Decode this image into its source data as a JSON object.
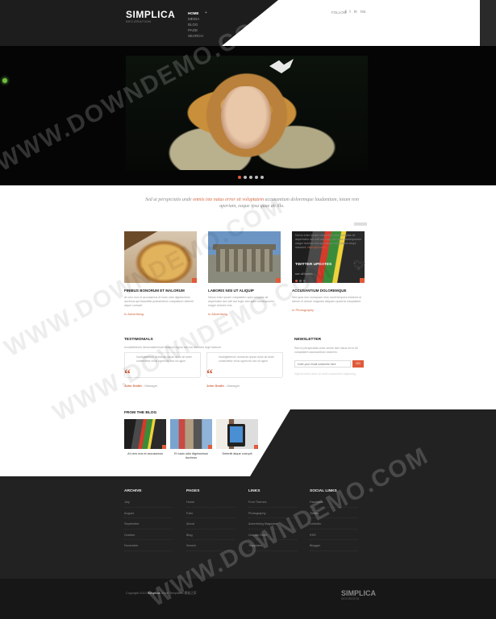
{
  "header": {
    "logo": "SIMPLICA",
    "logo_tag": "DECORATION",
    "nav": [
      "HOME",
      "MEDIA",
      "BLOG",
      "PAGE",
      "SEARCH"
    ],
    "nav_caret": "+",
    "follow": "FOLLOW",
    "social": [
      "f",
      "t",
      "in",
      "rss"
    ]
  },
  "hero": {
    "slides": [
      true,
      false,
      false,
      false,
      false
    ]
  },
  "intro": {
    "quote_lead": "Sed ut perspiciatis unde ",
    "quote_em": "omnis iste natus error sit voluptatem",
    "quote_tail": " accusantium doloremque laudantium, totam rem aperiam, eaque ipsa quae ab illo."
  },
  "features": [
    {
      "title": "FINIBUS BONORUM ET MALORUM",
      "text": "At vero eos et accusamus et iusto odio dignissimos ducimus qui blanditiis praesentium voluptatum deleniti atque corrupti.",
      "link": "In Advertising"
    },
    {
      "title": "LABORIS NISI UT ALIQUIP",
      "text": "Nemo enim ipsam voluptatem quia voluptas sit aspernatur aut odit aut fugit, sed quia consequuntur magni dolores eos.",
      "link": "In Advertising"
    },
    {
      "title": "ACCUSANTIUM DOLOREMQUE",
      "text": "Sed quia non numquam eius modi tempora incidunt ut labore et dolore magnam aliquam quaerat voluptatem.",
      "link": "In Photography"
    }
  ],
  "testimonials": {
    "title": "TESTIMONIALS",
    "subtitle": "Incolisiteteum denovostiremuel dolarum ligum nis hoc dolorem fugit labsunt.",
    "items": [
      {
        "text": "Incoligiteterum domorum ipsum dolor sit amet consectetur vivus ugum nis hoc sit ugum",
        "author": "John Smith",
        "role": " - Manager"
      },
      {
        "text": "Incoligiteterum domorum ipsum dolor sit amet consectetur vivus ugum nis hoc sit ugum",
        "author": "John Smith",
        "role": " - Manager"
      }
    ],
    "mark": "“"
  },
  "newsletter": {
    "title": "NEWSLETTER",
    "text": "Sed ut perspiciatis unde omnis iste natus error sit voluptatem accusantium dolorem.",
    "placeholder": "enter your email subscribe here",
    "button": "GO",
    "note": "Ingrum lorem dolor sit amet consectetur adipiscing"
  },
  "blog": {
    "title": "FROM THE BLOG",
    "posts": [
      {
        "title": "At vero eos et accusamus"
      },
      {
        "title": "Et iusto odio dignissimos ducimus"
      },
      {
        "title": "Deleniti atque corrupti"
      }
    ]
  },
  "twitter": {
    "text_lead": "Nemo enim ipsam voluptatem quia voluptas sit aspernatur aut odit aut fugit, sed quia consequuntur magni dolores eos qui ratione voluptatem sequi nesciunt. ",
    "text_link": "http://go.com/x",
    "title": "TWITTER UPDATES",
    "link": "see all tweets  →",
    "dots": [
      true,
      false,
      false
    ]
  },
  "footer": {
    "columns": [
      {
        "title": "ARCHIVE",
        "items": [
          "July",
          "August",
          "September",
          "October",
          "November"
        ]
      },
      {
        "title": "PAGES",
        "items": [
          "Home",
          "Folio",
          "About",
          "Blog",
          "Search"
        ]
      },
      {
        "title": "LINKS",
        "items": [
          "Free Themes",
          "Photography",
          "Advertising Magazine",
          "Graphic River",
          "Templates"
        ]
      },
      {
        "title": "SOCIAL LINKS",
        "items": [
          "Facebook",
          "Twitter",
          "LinkedIn",
          "RSS",
          "Blogger"
        ]
      }
    ],
    "copy_lead": "Copyright 2013 ",
    "copy_brand": "Simplica",
    "copy_tail": ". More Templates 模板之家",
    "logo": "SIMPLICA",
    "logo_tag": "DECORATION"
  },
  "watermark": "WWW.DOWNDEMO.COM"
}
